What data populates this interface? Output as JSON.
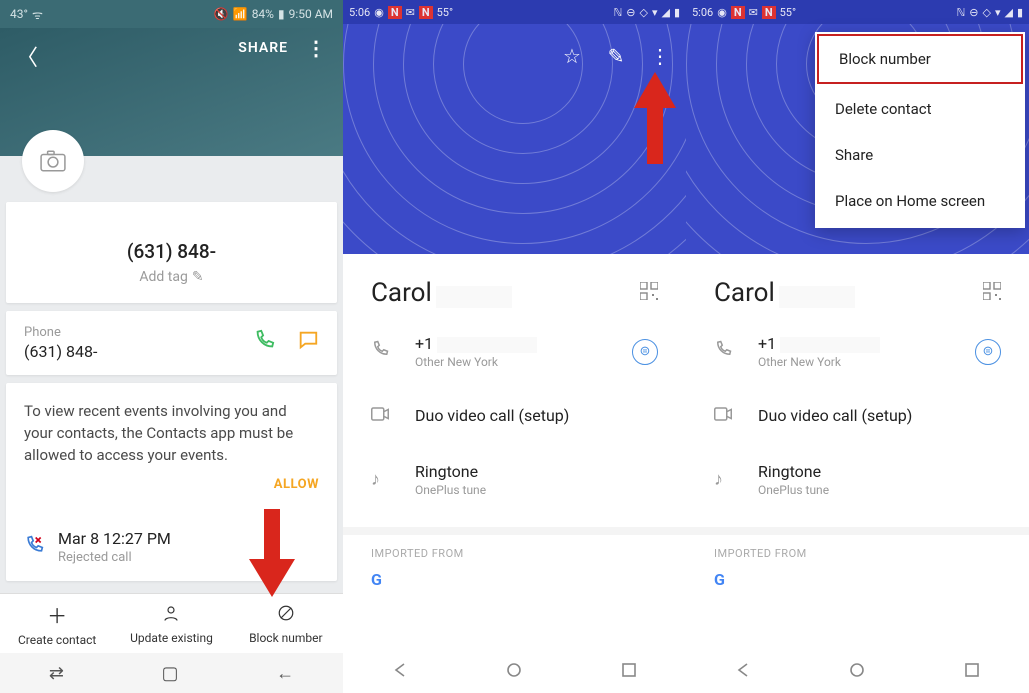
{
  "s1": {
    "status": {
      "temp": "43°",
      "battery_pct": "84%",
      "time": "9:50 AM"
    },
    "header": {
      "share": "SHARE"
    },
    "contact": {
      "name": "(631) 848-",
      "add_tag": "Add tag"
    },
    "phone": {
      "label": "Phone",
      "number": "(631) 848-"
    },
    "permission_msg": "To view recent events involving you and your contacts, the Contacts app must be allowed to access your events.",
    "allow": "ALLOW",
    "recent": {
      "time": "Mar 8 12:27 PM",
      "status": "Rejected call"
    },
    "bottom": {
      "create": "Create contact",
      "update": "Update existing",
      "block": "Block number"
    }
  },
  "s2": {
    "status": {
      "time": "5:06",
      "temp": "55°"
    },
    "name": "Carol",
    "phone": {
      "prefix": "+1",
      "sub": "Other New York"
    },
    "duo": "Duo video call (setup)",
    "ringtone": {
      "label": "Ringtone",
      "value": "OnePlus tune"
    },
    "imported": "IMPORTED FROM"
  },
  "s3": {
    "status": {
      "time": "5:06",
      "temp": "55°"
    },
    "name": "Carol",
    "phone": {
      "prefix": "+1",
      "sub": "Other New York"
    },
    "duo": "Duo video call (setup)",
    "ringtone": {
      "label": "Ringtone",
      "value": "OnePlus tune"
    },
    "imported": "IMPORTED FROM",
    "menu": {
      "block": "Block number",
      "delete": "Delete contact",
      "share": "Share",
      "home": "Place on Home screen"
    }
  }
}
